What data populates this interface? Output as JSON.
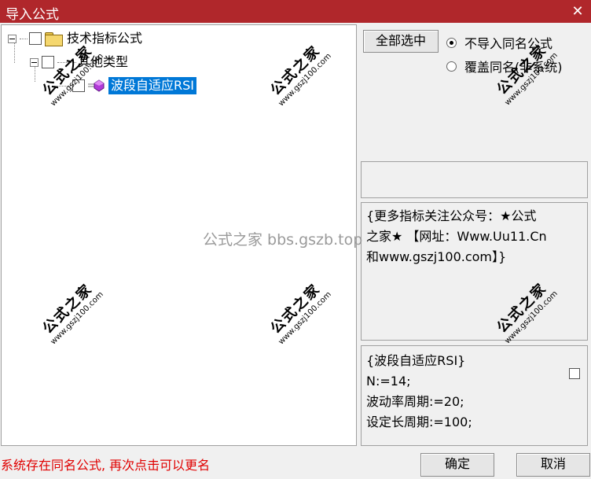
{
  "window": {
    "title": "导入公式",
    "close_label": "✕"
  },
  "tree": {
    "root": {
      "label": "技术指标公式"
    },
    "group": {
      "label": "其他类型"
    },
    "item": {
      "label": "波段自适应RSI"
    }
  },
  "actions": {
    "select_all_label": "全部选中"
  },
  "options": [
    {
      "label": "不导入同名公式",
      "selected": true
    },
    {
      "label": "覆盖同名(非系统)",
      "selected": false
    }
  ],
  "description": [
    "{更多指标关注公众号：★公式",
    "之家★ 【网址：Www.Uu11.Cn",
    "和www.gszj100.com】}"
  ],
  "code_lines": [
    "{波段自适应RSI}",
    "N:=14;",
    "波动率周期:=20;",
    "设定长周期:=100;"
  ],
  "watermark": {
    "brand": "公式之家",
    "url": "www.gszj100.com",
    "center": "公式之家 bbs.gszb.top"
  },
  "status": {
    "message": "系统存在同名公式, 再次点击可以更名"
  },
  "footer": {
    "ok_label": "确定",
    "cancel_label": "取消"
  }
}
